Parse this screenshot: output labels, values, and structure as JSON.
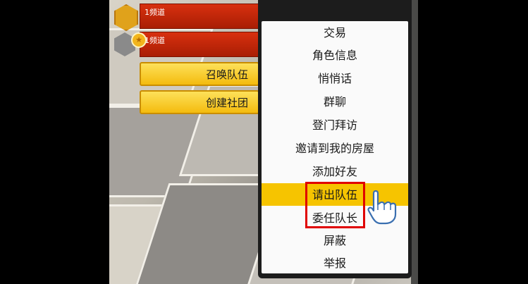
{
  "channels": [
    {
      "label": "1频道"
    },
    {
      "label": "1频道"
    }
  ],
  "side_buttons": {
    "summon": "召唤队伍",
    "guild": "创建社团"
  },
  "menu": {
    "items": [
      "交易",
      "角色信息",
      "悄悄话",
      "群聊",
      "登门拜访",
      "邀请到我的房屋",
      "添加好友",
      "请出队伍",
      "委任队长",
      "屏蔽",
      "举报"
    ],
    "highlighted_index": 7,
    "annotated_items": [
      "请出队伍",
      "委任队长"
    ]
  },
  "colors": {
    "highlight": "#f6c400",
    "annotation_box": "#e00000",
    "channel_bar": "#c02408",
    "button": "#f9d23a"
  },
  "icons": [
    "hexagon-gold-icon",
    "hexagon-grey-icon",
    "medal-icon",
    "pointing-hand-icon"
  ]
}
